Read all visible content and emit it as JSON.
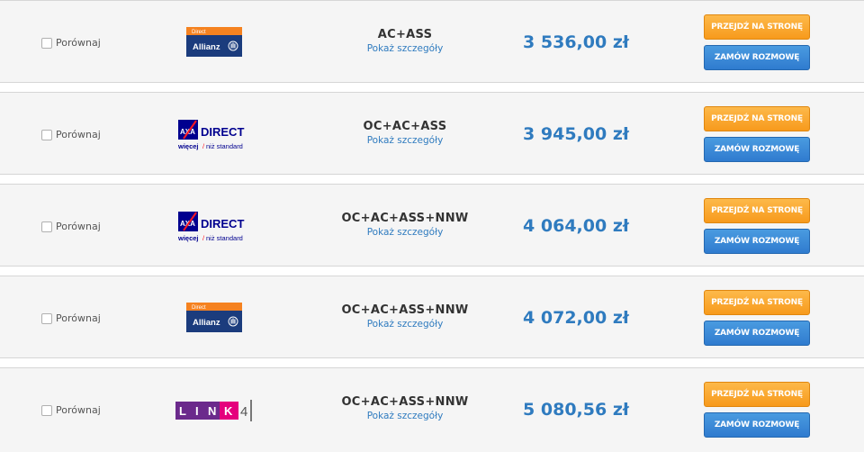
{
  "compare_label": "Porównaj",
  "details_link": "Pokaż szczegóły",
  "goto_button": "PRZEJDŹ NA STRONĘ",
  "order_call_button": "ZAMÓW ROZMOWĘ",
  "offers": [
    {
      "insurer": "Allianz Direct",
      "plan": "AC+ASS",
      "price": "3 536,00 zł"
    },
    {
      "insurer": "AXA Direct",
      "plan": "OC+AC+ASS",
      "price": "3 945,00 zł"
    },
    {
      "insurer": "AXA Direct",
      "plan": "OC+AC+ASS+NNW",
      "price": "4 064,00 zł"
    },
    {
      "insurer": "Allianz Direct",
      "plan": "OC+AC+ASS+NNW",
      "price": "4 072,00 zł"
    },
    {
      "insurer": "LINK4",
      "plan": "OC+AC+ASS+NNW",
      "price": "5 080,56 zł"
    }
  ],
  "logos": {
    "allianz": {
      "top": "Direct",
      "main": "Allianz"
    },
    "axa": {
      "brand": "AXA",
      "main": "DIRECT",
      "tag_a": "więcej",
      "tag_b": "niż standard"
    },
    "link4": {
      "letters": [
        "L",
        "I",
        "N",
        "K"
      ],
      "digit": "4"
    }
  },
  "colors": {
    "price": "#2f7bbf",
    "link": "#2f7bbf",
    "orange_button": "#f79a1c",
    "blue_button": "#2f7bcf",
    "allianz_navy": "#1b3c7d",
    "allianz_orange": "#f58220",
    "axa_blue": "#00008f",
    "axa_red": "#ff1721",
    "link4_purple": "#6b2a8c",
    "link4_pink": "#e5007d"
  },
  "icons": [
    "checkbox-icon",
    "allianz-eagle-icon",
    "axa-slash-icon"
  ]
}
